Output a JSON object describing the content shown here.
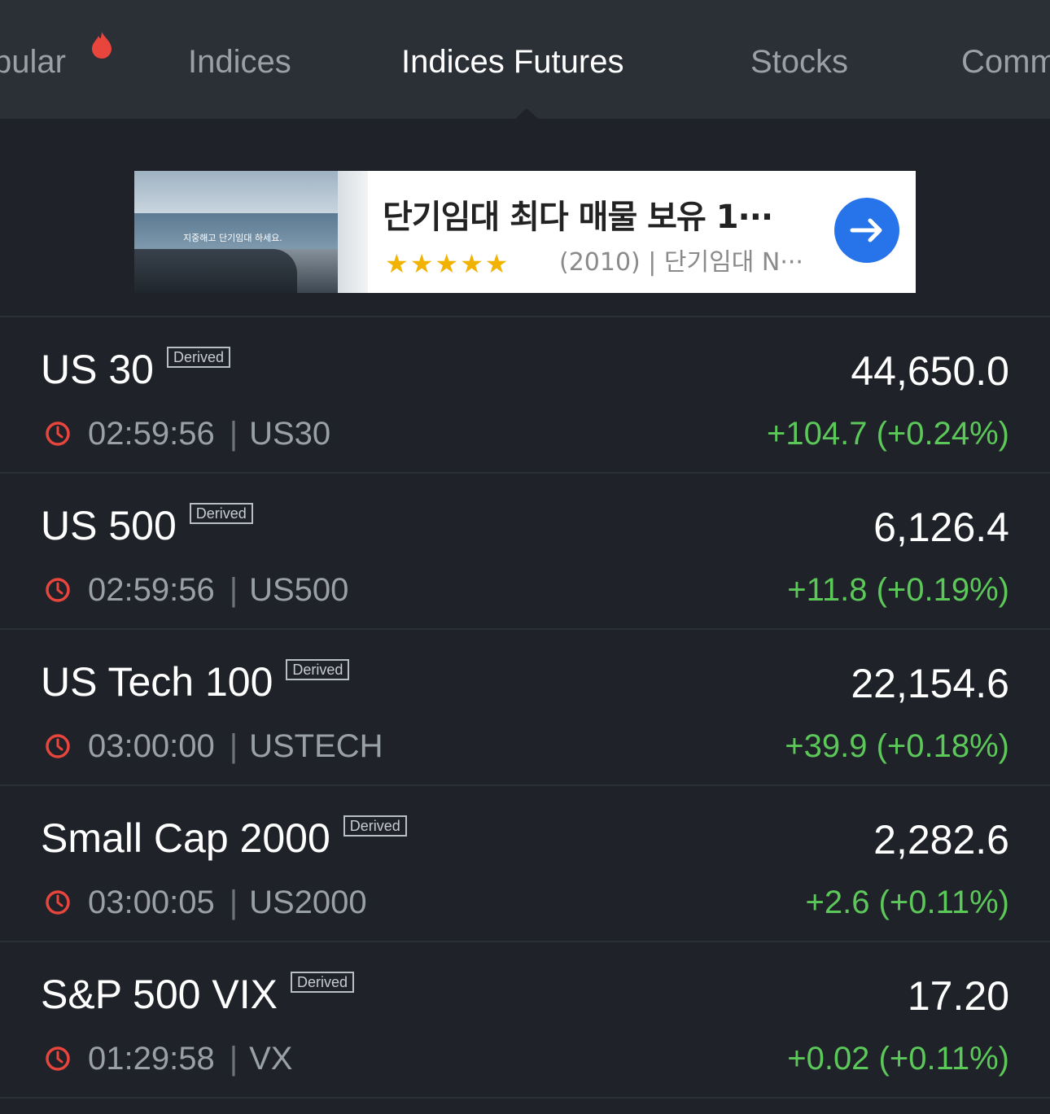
{
  "tabs": [
    {
      "label": "pular",
      "active": false
    },
    {
      "label": "Indices",
      "active": false
    },
    {
      "label": "Indices Futures",
      "active": true
    },
    {
      "label": "Stocks",
      "active": false
    },
    {
      "label": "Comm",
      "active": false
    }
  ],
  "ad": {
    "image_caption": "지중해고 단기임대 하세요.",
    "title": "단기임대 최다 매물 보유 1···",
    "rating": "4.5",
    "stars": "★★★★★",
    "subtitle": "(2010) | 단기임대 N···",
    "star_color": "#f2b200",
    "button_color": "#2673ea"
  },
  "badge_label": "Derived",
  "positive_color": "#5cc85a",
  "clock_color": "#e8453c",
  "rows": [
    {
      "name": "US 30",
      "time": "02:59:56",
      "symbol": "US30",
      "price": "44,650.0",
      "change": "+104.7 (+0.24%)"
    },
    {
      "name": "US 500",
      "time": "02:59:56",
      "symbol": "US500",
      "price": "6,126.4",
      "change": "+11.8 (+0.19%)"
    },
    {
      "name": "US Tech 100",
      "time": "03:00:00",
      "symbol": "USTECH",
      "price": "22,154.6",
      "change": "+39.9 (+0.18%)"
    },
    {
      "name": "Small Cap 2000",
      "time": "03:00:05",
      "symbol": "US2000",
      "price": "2,282.6",
      "change": "+2.6 (+0.11%)"
    },
    {
      "name": "S&P 500 VIX",
      "time": "01:29:58",
      "symbol": "VX",
      "price": "17.20",
      "change": "+0.02 (+0.11%)"
    }
  ]
}
